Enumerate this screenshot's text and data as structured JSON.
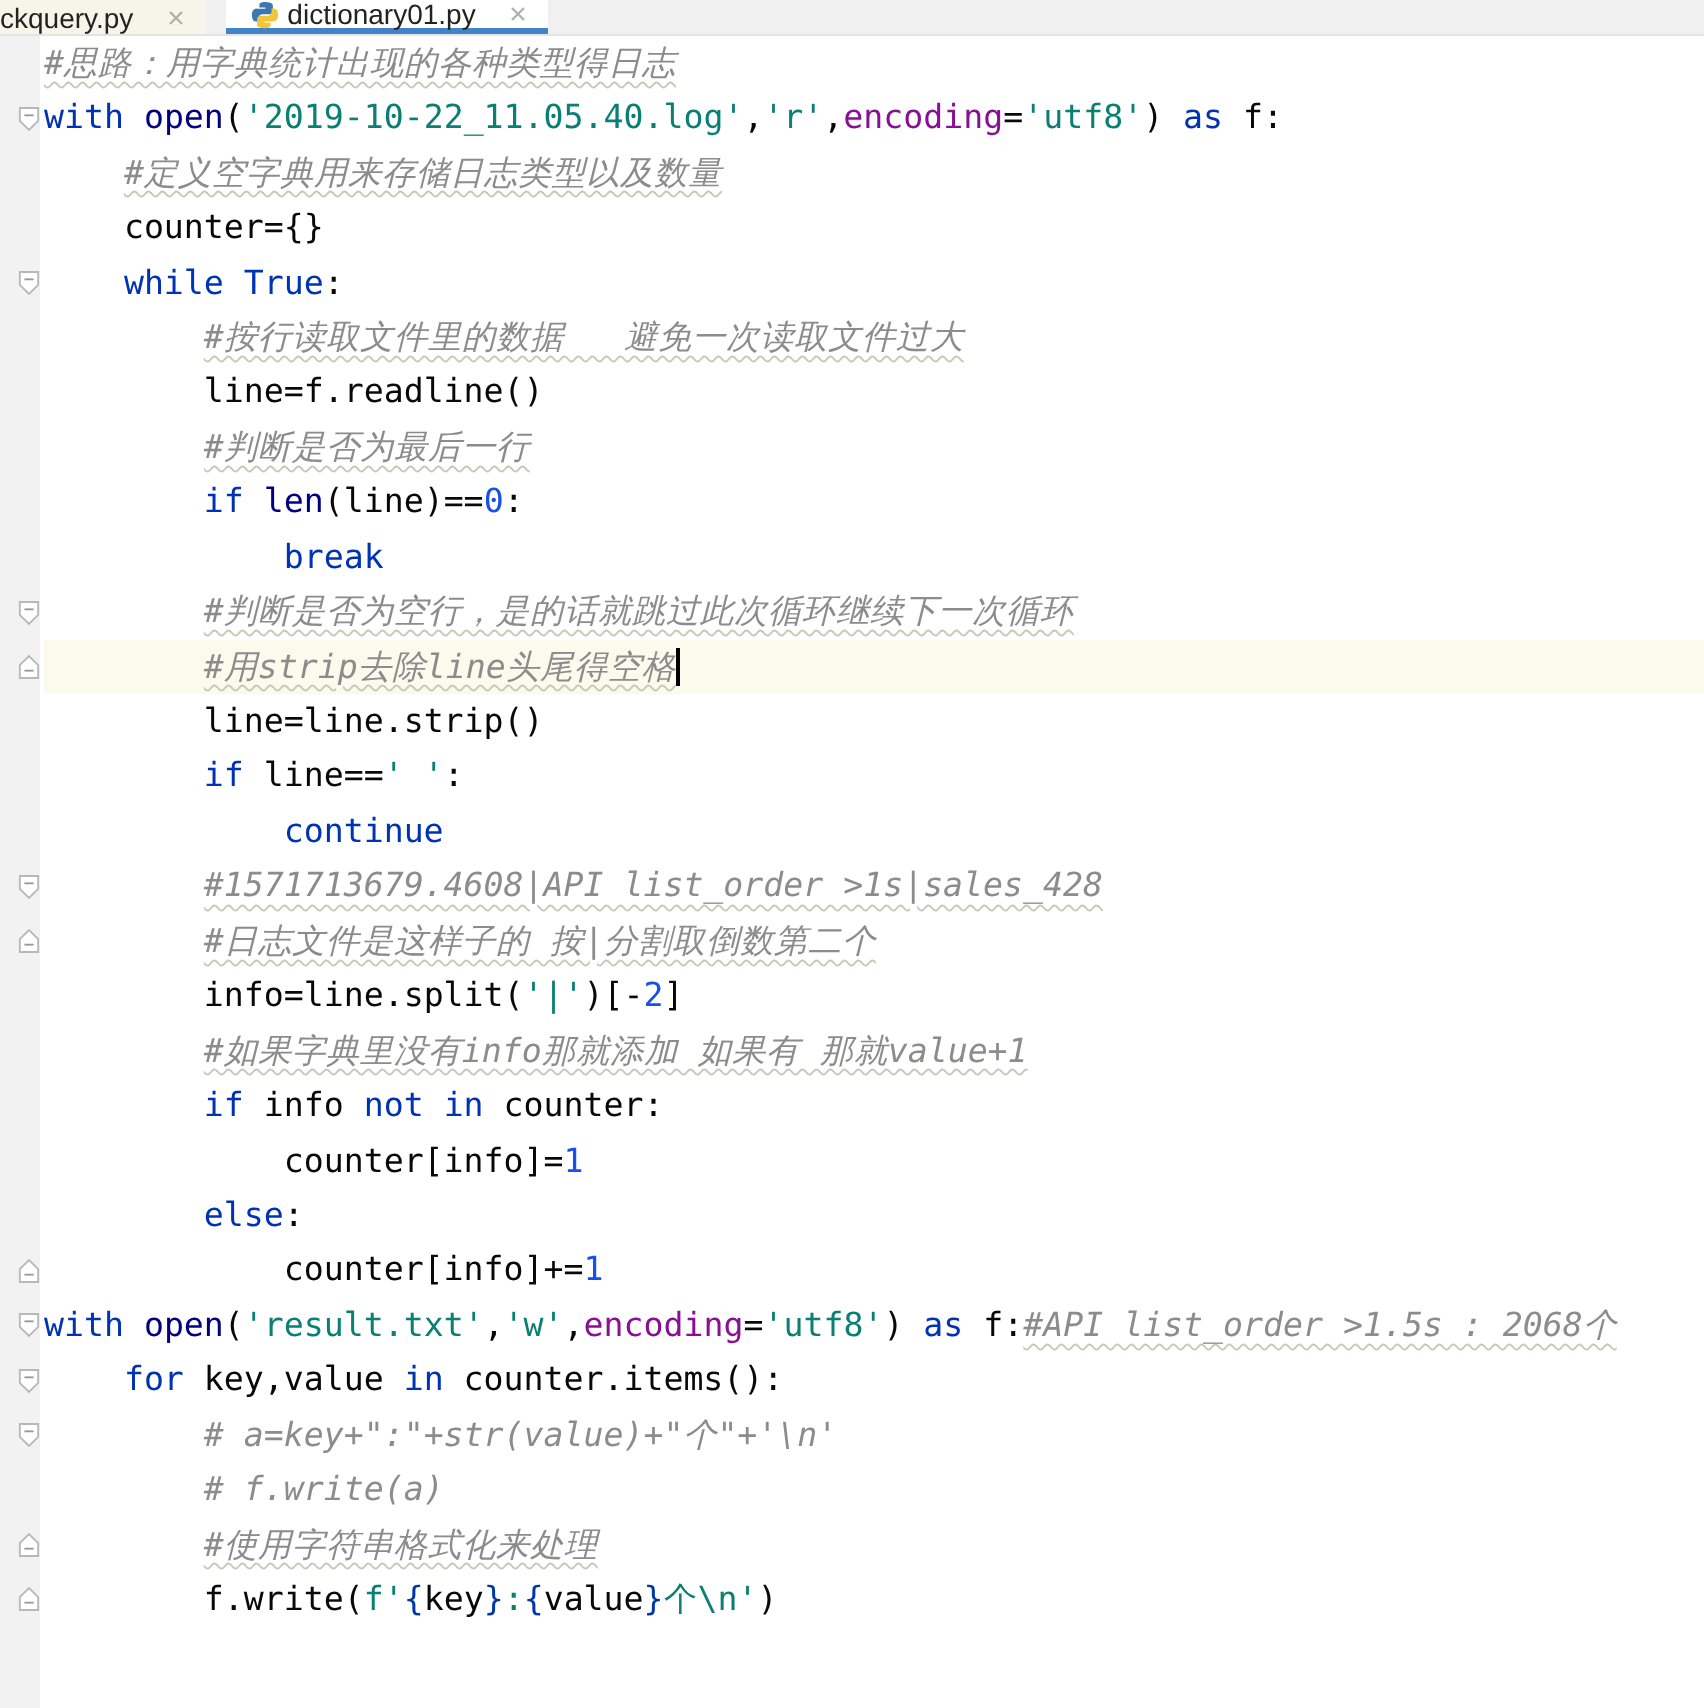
{
  "tabs": [
    {
      "label": "ckquery.py",
      "selected": false,
      "icon": false
    },
    {
      "label": "dictionary01.py",
      "selected": true,
      "icon": true
    }
  ],
  "lines": [
    {
      "fold_start": false,
      "fold_end": false,
      "squiggle": true,
      "current": false,
      "tokens": [
        {
          "kind": "comment",
          "text": "#思路：用字典统计出现的各种类型得日志"
        }
      ]
    },
    {
      "fold_start": true,
      "fold_end": false,
      "current": false,
      "tokens": [
        {
          "kind": "keyword",
          "text": "with"
        },
        {
          "kind": "builtin",
          "text": "open",
          "space": true
        },
        {
          "kind": "plain",
          "text": "("
        },
        {
          "kind": "string",
          "text": "'2019-10-22_11.05.40.log'"
        },
        {
          "kind": "plain",
          "text": ","
        },
        {
          "kind": "string",
          "text": "'r'"
        },
        {
          "kind": "plain",
          "text": ","
        },
        {
          "kind": "param",
          "text": "encoding"
        },
        {
          "kind": "plain",
          "text": "="
        },
        {
          "kind": "string",
          "text": "'utf8'"
        },
        {
          "kind": "plain",
          "text": ")"
        },
        {
          "kind": "keyword",
          "text": "as",
          "space": true
        },
        {
          "kind": "plain",
          "text": "f:",
          "space": true
        }
      ],
      "children": [
        {
          "fold_start": false,
          "fold_end": false,
          "squiggle": true,
          "current": false,
          "tokens": [
            {
              "kind": "comment",
              "text": "#定义空字典用来存储日志类型以及数量"
            }
          ]
        },
        {
          "fold_start": false,
          "fold_end": false,
          "current": false,
          "tokens": [
            {
              "kind": "plain",
              "text": "counter={}"
            }
          ]
        },
        {
          "fold_start": true,
          "fold_end": false,
          "current": false,
          "tokens": [
            {
              "kind": "keyword",
              "text": "while"
            },
            {
              "kind": "keyword",
              "text": "True",
              "space": true
            },
            {
              "kind": "plain",
              "text": ":"
            }
          ],
          "children": [
            {
              "fold_start": false,
              "fold_end": false,
              "squiggle": true,
              "current": false,
              "tokens": [
                {
                  "kind": "comment",
                  "text": "#按行读取文件里的数据   避免一次读取文件过大"
                }
              ]
            },
            {
              "fold_start": false,
              "fold_end": false,
              "current": false,
              "tokens": [
                {
                  "kind": "plain",
                  "text": "line=f.readline()"
                }
              ]
            },
            {
              "fold_start": false,
              "fold_end": false,
              "squiggle": true,
              "current": false,
              "tokens": [
                {
                  "kind": "comment",
                  "text": "#判断是否为最后一行"
                }
              ]
            },
            {
              "fold_start": false,
              "fold_end": false,
              "current": false,
              "tokens": [
                {
                  "kind": "keyword",
                  "text": "if"
                },
                {
                  "kind": "builtin",
                  "text": "len",
                  "space": true
                },
                {
                  "kind": "plain",
                  "text": "(line)=="
                },
                {
                  "kind": "number",
                  "text": "0"
                },
                {
                  "kind": "plain",
                  "text": ":"
                }
              ],
              "children": [
                {
                  "fold_start": false,
                  "fold_end": false,
                  "current": false,
                  "tokens": [
                    {
                      "kind": "keyword",
                      "text": "break"
                    }
                  ]
                }
              ]
            },
            {
              "fold_start": true,
              "fold_end": false,
              "squiggle": true,
              "current": false,
              "tokens": [
                {
                  "kind": "comment",
                  "text": "#判断是否为空行，是的话就跳过此次循环继续下一次循环"
                }
              ]
            },
            {
              "fold_start": false,
              "fold_end": true,
              "squiggle": true,
              "current": true,
              "tokens": [
                {
                  "kind": "comment",
                  "text": "#用strip去除line头尾得空格"
                }
              ]
            },
            {
              "fold_start": false,
              "fold_end": false,
              "current": false,
              "tokens": [
                {
                  "kind": "plain",
                  "text": "line=line.strip()"
                }
              ]
            },
            {
              "fold_start": false,
              "fold_end": false,
              "current": false,
              "tokens": [
                {
                  "kind": "keyword",
                  "text": "if"
                },
                {
                  "kind": "plain",
                  "text": "line==",
                  "space": true
                },
                {
                  "kind": "string",
                  "text": "' '"
                },
                {
                  "kind": "plain",
                  "text": ":"
                }
              ],
              "children": [
                {
                  "fold_start": false,
                  "fold_end": false,
                  "current": false,
                  "tokens": [
                    {
                      "kind": "keyword",
                      "text": "continue"
                    }
                  ]
                }
              ]
            },
            {
              "fold_start": true,
              "fold_end": false,
              "squiggle": true,
              "current": false,
              "tokens": [
                {
                  "kind": "comment",
                  "text": "#1571713679.4608|API list_order >1s|sales_428"
                }
              ]
            },
            {
              "fold_start": false,
              "fold_end": true,
              "squiggle": true,
              "current": false,
              "tokens": [
                {
                  "kind": "comment",
                  "text": "#日志文件是这样子的 按|分割取倒数第二个"
                }
              ]
            },
            {
              "fold_start": false,
              "fold_end": false,
              "current": false,
              "tokens": [
                {
                  "kind": "plain",
                  "text": "info=line.split("
                },
                {
                  "kind": "string",
                  "text": "'|'"
                },
                {
                  "kind": "plain",
                  "text": ")[-"
                },
                {
                  "kind": "number",
                  "text": "2"
                },
                {
                  "kind": "plain",
                  "text": "]"
                }
              ]
            },
            {
              "fold_start": false,
              "fold_end": false,
              "squiggle": true,
              "current": false,
              "tokens": [
                {
                  "kind": "comment",
                  "text": "#如果字典里没有info那就添加 如果有 那就value+1"
                }
              ]
            },
            {
              "fold_start": false,
              "fold_end": false,
              "current": false,
              "tokens": [
                {
                  "kind": "keyword",
                  "text": "if"
                },
                {
                  "kind": "plain",
                  "text": "info",
                  "space": true
                },
                {
                  "kind": "keyword",
                  "text": "not",
                  "space": true
                },
                {
                  "kind": "keyword",
                  "text": "in",
                  "space": true
                },
                {
                  "kind": "plain",
                  "text": "counter:",
                  "space": true
                }
              ],
              "children": [
                {
                  "fold_start": false,
                  "fold_end": false,
                  "current": false,
                  "tokens": [
                    {
                      "kind": "plain",
                      "text": "counter[info]="
                    },
                    {
                      "kind": "number",
                      "text": "1"
                    }
                  ]
                }
              ]
            },
            {
              "fold_start": false,
              "fold_end": false,
              "current": false,
              "tokens": [
                {
                  "kind": "keyword",
                  "text": "else"
                },
                {
                  "kind": "plain",
                  "text": ":"
                }
              ],
              "children": [
                {
                  "fold_start": false,
                  "fold_end": true,
                  "current": false,
                  "tokens": [
                    {
                      "kind": "plain",
                      "text": "counter[info]+="
                    },
                    {
                      "kind": "number",
                      "text": "1"
                    }
                  ]
                }
              ]
            }
          ]
        }
      ]
    },
    {
      "fold_start": true,
      "fold_end": false,
      "squiggle": true,
      "current": false,
      "tokens": [
        {
          "kind": "keyword",
          "text": "with"
        },
        {
          "kind": "builtin",
          "text": "open",
          "space": true
        },
        {
          "kind": "plain",
          "text": "("
        },
        {
          "kind": "string",
          "text": "'result.txt'"
        },
        {
          "kind": "plain",
          "text": ","
        },
        {
          "kind": "string",
          "text": "'w'"
        },
        {
          "kind": "plain",
          "text": ","
        },
        {
          "kind": "param",
          "text": "encoding"
        },
        {
          "kind": "plain",
          "text": "="
        },
        {
          "kind": "string",
          "text": "'utf8'"
        },
        {
          "kind": "plain",
          "text": ")"
        },
        {
          "kind": "keyword",
          "text": "as",
          "space": true
        },
        {
          "kind": "plain",
          "text": "f:",
          "space": true
        },
        {
          "kind": "comment",
          "text": "#API list_order >1.5s : 2068个"
        }
      ],
      "children": [
        {
          "fold_start": true,
          "fold_end": false,
          "current": false,
          "tokens": [
            {
              "kind": "keyword",
              "text": "for"
            },
            {
              "kind": "plain",
              "text": "key,value",
              "space": true
            },
            {
              "kind": "keyword",
              "text": "in",
              "space": true
            },
            {
              "kind": "plain",
              "text": "counter.items():",
              "space": true
            }
          ],
          "children": [
            {
              "fold_start": true,
              "fold_end": false,
              "squiggle": false,
              "current": false,
              "tokens": [
                {
                  "kind": "comment",
                  "text": "# a=key+\":\"+str(value)+\"个\"+'\\n'"
                }
              ]
            },
            {
              "fold_start": false,
              "fold_end": false,
              "squiggle": false,
              "current": false,
              "tokens": [
                {
                  "kind": "comment",
                  "text": "# f.write(a)"
                }
              ]
            },
            {
              "fold_start": false,
              "fold_end": true,
              "squiggle": true,
              "current": false,
              "tokens": [
                {
                  "kind": "comment",
                  "text": "#使用字符串格式化来处理"
                }
              ]
            },
            {
              "fold_start": false,
              "fold_end": true,
              "current": false,
              "tokens": [
                {
                  "kind": "plain",
                  "text": "f.write("
                },
                {
                  "kind": "string",
                  "text": "f'"
                },
                {
                  "kind": "brace",
                  "text": "{"
                },
                {
                  "kind": "plain",
                  "text": "key"
                },
                {
                  "kind": "brace",
                  "text": "}"
                },
                {
                  "kind": "string",
                  "text": ":"
                },
                {
                  "kind": "brace",
                  "text": "{"
                },
                {
                  "kind": "plain",
                  "text": "value"
                },
                {
                  "kind": "brace",
                  "text": "}"
                },
                {
                  "kind": "string",
                  "text": "个\\n'"
                },
                {
                  "kind": "plain",
                  "text": ")"
                }
              ]
            }
          ]
        }
      ]
    }
  ]
}
